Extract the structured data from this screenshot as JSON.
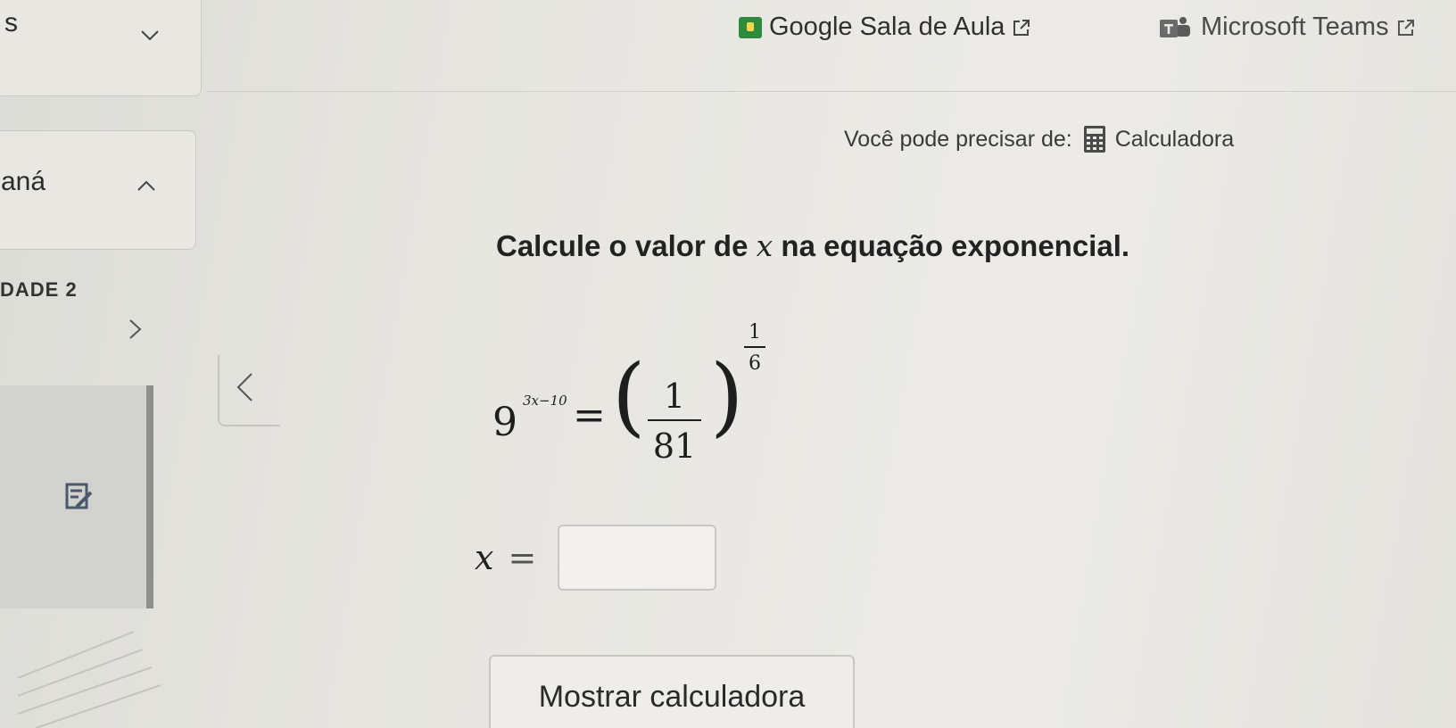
{
  "sidebar": {
    "card1_text": "s",
    "card2_text": "aná",
    "item3_text": "DADE 2"
  },
  "topbar": {
    "google_link": "Google Sala de Aula",
    "teams_link": "Microsoft Teams"
  },
  "content": {
    "need_label": "Você pode precisar de:",
    "calculator_label": "Calculadora",
    "question_prefix": "Calcule o valor de",
    "question_var": "x",
    "question_suffix": "na equação exponencial.",
    "equation": {
      "base": "9",
      "exponent": "3x−10",
      "equals": "=",
      "open_paren": "(",
      "close_paren": ")",
      "frac_num": "1",
      "frac_den": "81",
      "outer_exp_num": "1",
      "outer_exp_den": "6"
    },
    "answer_var": "x",
    "answer_equals": "=",
    "answer_value": "",
    "show_calc_button": "Mostrar calculadora"
  },
  "colors": {
    "background": "#e9e8e3",
    "google_green": "#2e8b3d",
    "text": "#2a2a2a"
  }
}
